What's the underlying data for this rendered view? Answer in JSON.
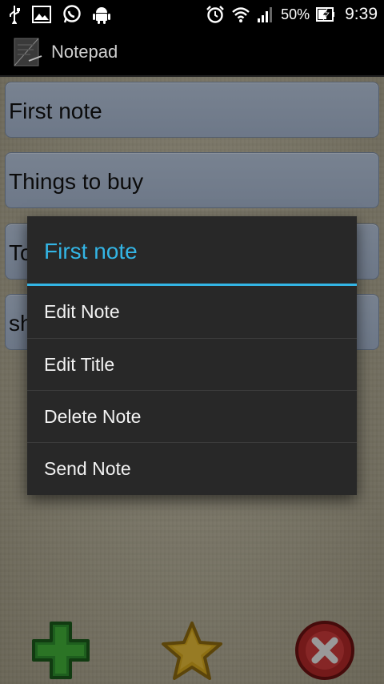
{
  "status_bar": {
    "battery_percent": "50%",
    "time": "9:39",
    "left_icons": [
      "usb-icon",
      "image-icon",
      "whatsapp-icon",
      "android-icon"
    ],
    "right_icons": [
      "alarm-icon",
      "wifi-icon",
      "signal-icon",
      "battery-charging-icon"
    ]
  },
  "app": {
    "title": "Notepad"
  },
  "notes": [
    {
      "label": "First note"
    },
    {
      "label": "Things to buy"
    },
    {
      "label": "To"
    },
    {
      "label": "sh"
    }
  ],
  "dialog": {
    "title": "First note",
    "items": [
      {
        "label": "Edit Note"
      },
      {
        "label": "Edit Title"
      },
      {
        "label": "Delete Note"
      },
      {
        "label": "Send Note"
      }
    ]
  },
  "bottom_bar": {
    "buttons": [
      "add-icon",
      "favorite-star-icon",
      "close-icon"
    ]
  },
  "colors": {
    "accent": "#33b5e5",
    "dialog_bg": "#282828",
    "note_bg": "#b0c0d8",
    "add_green": "#2fa52f",
    "star_yellow": "#e0b020",
    "close_red": "#c03030"
  }
}
